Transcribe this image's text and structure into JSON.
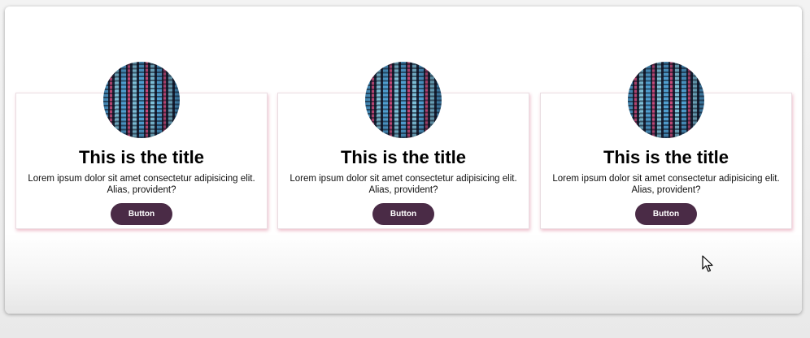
{
  "cards": [
    {
      "title": "This is the title",
      "text": "Lorem ipsum dolor sit amet consectetur adipisicing elit. Alias, provident?",
      "button_label": "Button"
    },
    {
      "title": "This is the title",
      "text": "Lorem ipsum dolor sit amet consectetur adipisicing elit. Alias, provident?",
      "button_label": "Button"
    },
    {
      "title": "This is the title",
      "text": "Lorem ipsum dolor sit amet consectetur adipisicing elit. Alias, provident?",
      "button_label": "Button"
    }
  ],
  "colors": {
    "button": "#4a2b46",
    "card_shadow": "#d66e8c"
  },
  "icons": {
    "card_image": "code-screen-image",
    "cursor": "mouse-pointer-icon"
  }
}
